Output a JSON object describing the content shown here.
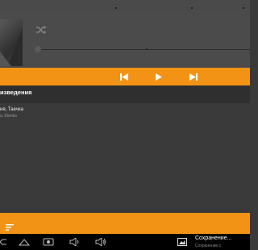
{
  "app": {
    "accent_color": "#f39315",
    "background_color": "#3a3a3a"
  },
  "player": {
    "album_art": "album-art",
    "shuffle_icon": "shuffle-icon",
    "seek_position": 0.0
  },
  "transport": {
    "prev_icon": "skip-previous-icon",
    "play_icon": "play-icon",
    "next_icon": "skip-next-icon"
  },
  "queue": {
    "title": "изведения",
    "tracks": [
      {
        "title": "ня, Таечка",
        "artist": "а, Elenko"
      }
    ]
  },
  "bottom_bar": {
    "menu_icon": "queue-list-icon"
  },
  "nav_bar": {
    "icons": [
      "back-icon",
      "home-icon",
      "recent-apps-icon",
      "volume-down-icon",
      "volume-up-icon"
    ],
    "notification": {
      "text": "Сохранение...",
      "subtext": "Сохранение с"
    }
  }
}
